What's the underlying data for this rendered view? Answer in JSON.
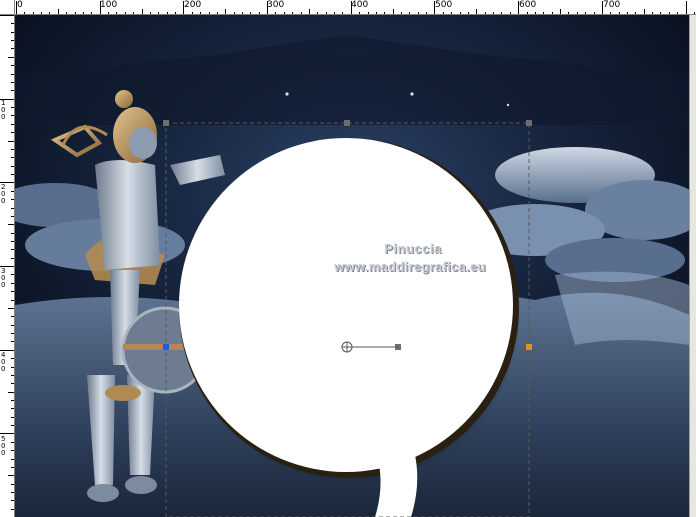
{
  "ruler": {
    "top_labels": [
      "0",
      "100",
      "200",
      "300",
      "400",
      "500",
      "600",
      "700"
    ],
    "left_labels": [
      "1 0 0",
      "2 0 0",
      "3 0 0",
      "4 0 0",
      "5 0 0"
    ]
  },
  "canvas": {
    "watermark_name": "Pinuccia",
    "watermark_url": "www.maddiregrafica.eu"
  },
  "colors": {
    "selection_line": "#5a5a5a",
    "shape_fill": "#ffffff",
    "sky_dark": "#0b1424",
    "cloud": "#8fa6c4",
    "armor": "#a9b4c2",
    "gold": "#b08a52"
  },
  "icons": {
    "rotation_center": "crosshair-circle-icon",
    "selection_handle": "square-handle-icon"
  }
}
